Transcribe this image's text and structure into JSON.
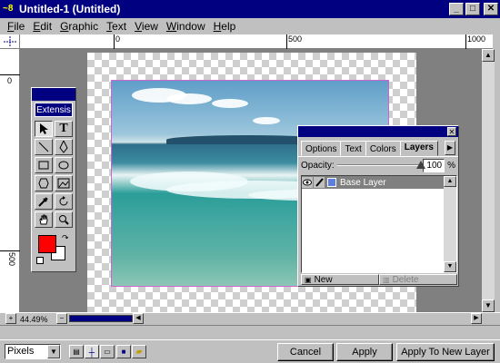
{
  "window": {
    "title": "Untitled-1 (Untitled)",
    "app_icon_text": "~8",
    "minimize": "_",
    "maximize": "□",
    "close": "✕"
  },
  "menu": [
    "File",
    "Edit",
    "Graphic",
    "Text",
    "View",
    "Window",
    "Help"
  ],
  "ruler": {
    "top_labels": [
      "0",
      "500",
      "1000"
    ],
    "left_labels": [
      "0",
      "500"
    ]
  },
  "toolbox": {
    "title": "Extensis"
  },
  "colors": {
    "foreground": "#ff0000",
    "background": "#ffffff",
    "selection_outline": "#cc66cc"
  },
  "layers_panel": {
    "tabs": [
      "Options",
      "Text",
      "Colors",
      "Layers"
    ],
    "active_tab": "Layers",
    "opacity_label": "Opacity:",
    "opacity_value": "100",
    "opacity_unit": "%",
    "opacity_fraction": 1.0,
    "layers": [
      {
        "name": "Base Layer",
        "visible": true
      }
    ],
    "new_label": "New",
    "delete_label": "Delete"
  },
  "status": {
    "zoom": "44.49%"
  },
  "bottom": {
    "units": "Pixels",
    "cancel": "Cancel",
    "apply": "Apply",
    "apply_new": "Apply To New Layer"
  }
}
